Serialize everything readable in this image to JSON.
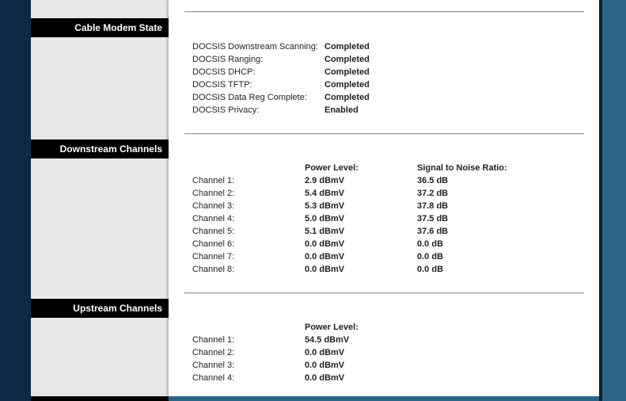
{
  "sections": {
    "cable_modem_state": "Cable Modem State",
    "downstream_channels": "Downstream Channels",
    "upstream_channels": "Upstream Channels"
  },
  "modem_state": [
    {
      "label": "DOCSIS Downstream Scanning:",
      "value": "Completed"
    },
    {
      "label": "DOCSIS Ranging:",
      "value": "Completed"
    },
    {
      "label": "DOCSIS DHCP:",
      "value": "Completed"
    },
    {
      "label": "DOCSIS TFTP:",
      "value": "Completed"
    },
    {
      "label": "DOCSIS Data Reg Complete:",
      "value": "Completed"
    },
    {
      "label": "DOCSIS Privacy:",
      "value": "Enabled"
    }
  ],
  "downstream": {
    "power_header": "Power Level:",
    "snr_header": "Signal to Noise Ratio:",
    "channels": [
      {
        "label": "Channel 1:",
        "power": "2.9 dBmV",
        "snr": "36.5 dB"
      },
      {
        "label": "Channel 2:",
        "power": "5.4 dBmV",
        "snr": "37.2 dB"
      },
      {
        "label": "Channel 3:",
        "power": "5.3 dBmV",
        "snr": "37.8 dB"
      },
      {
        "label": "Channel 4:",
        "power": "5.0 dBmV",
        "snr": "37.5 dB"
      },
      {
        "label": "Channel 5:",
        "power": "5.1 dBmV",
        "snr": "37.6 dB"
      },
      {
        "label": "Channel 6:",
        "power": "0.0 dBmV",
        "snr": "0.0 dB"
      },
      {
        "label": "Channel 7:",
        "power": "0.0 dBmV",
        "snr": "0.0 dB"
      },
      {
        "label": "Channel 8:",
        "power": "0.0 dBmV",
        "snr": "0.0 dB"
      }
    ]
  },
  "upstream": {
    "power_header": "Power Level:",
    "channels": [
      {
        "label": "Channel 1:",
        "power": "54.5 dBmV"
      },
      {
        "label": "Channel 2:",
        "power": "0.0 dBmV"
      },
      {
        "label": "Channel 3:",
        "power": "0.0 dBmV"
      },
      {
        "label": "Channel 4:",
        "power": "0.0 dBmV"
      }
    ]
  }
}
